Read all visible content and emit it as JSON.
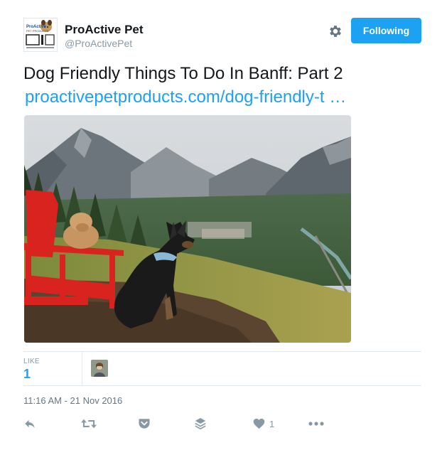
{
  "user": {
    "name": "ProActive Pet",
    "handle": "@ProActivePet",
    "avatar_icon": "proactive-pet-logo",
    "avatar_text": "ProActive Pet Products"
  },
  "header": {
    "follow_button_label": "Following",
    "settings_icon": "gear-icon"
  },
  "tweet": {
    "text": "Dog Friendly Things To Do In Banff: Part 2",
    "link": "proactivepetproducts.com/dog-friendly-t …"
  },
  "photo": {
    "icon": "photo-of-dogs-in-red-chair-overlooking-banff"
  },
  "stats": {
    "like_label": "LIKE",
    "like_count": "1"
  },
  "timestamp": "11:16 AM - 21 Nov 2016",
  "actions": {
    "like_count": "1",
    "icons": [
      "reply-icon",
      "retweet-icon",
      "pocket-icon",
      "layers-icon",
      "heart-icon",
      "more-icon"
    ]
  },
  "colors": {
    "accent": "#1da1f2",
    "muted": "#8899a6",
    "text": "#14171a"
  }
}
